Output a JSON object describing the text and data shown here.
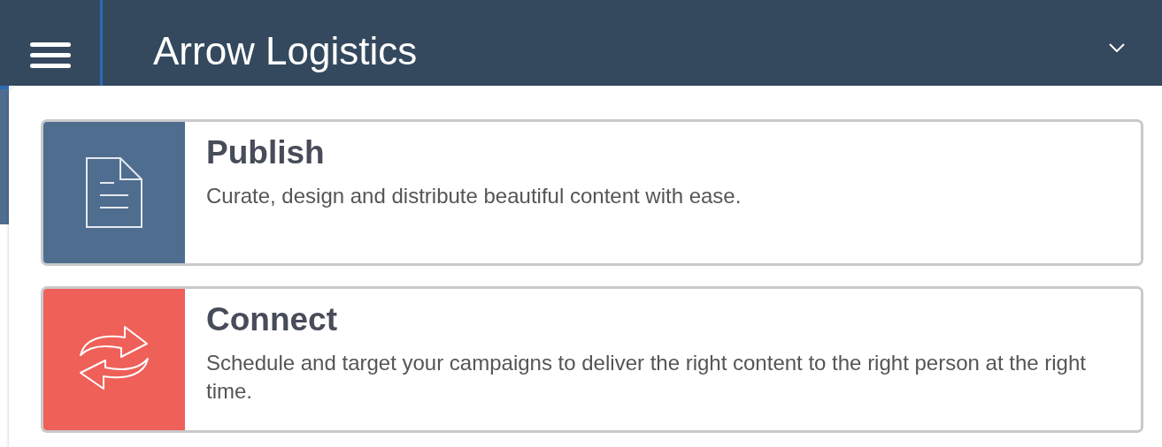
{
  "header": {
    "title": "Arrow Logistics"
  },
  "cards": [
    {
      "title": "Publish",
      "description": "Curate, design and distribute beautiful content with ease.",
      "color": "#4f6d8f",
      "kind": "document"
    },
    {
      "title": "Connect",
      "description": "Schedule and target your campaigns to deliver the right content to the right person at the right time.",
      "color": "#ef6059",
      "kind": "arrows"
    }
  ]
}
